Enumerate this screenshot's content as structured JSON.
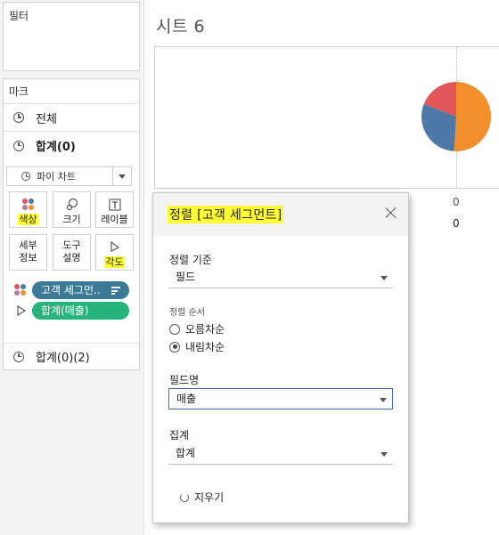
{
  "filters": {
    "title": "필터"
  },
  "marks": {
    "title": "마크",
    "all_label": "전체",
    "sum_label": "합계(0)",
    "mark_type": "파이 차트",
    "tiles": {
      "color": "색상",
      "size": "크기",
      "label": "레이블",
      "detail": "세부\n정보",
      "tooltip": "도구\n설명",
      "angle": "각도"
    },
    "pills": [
      {
        "text": "고객 세그먼..",
        "color": "#3a7a96"
      },
      {
        "text": "합계(매출)",
        "color": "#27b37c"
      }
    ],
    "sum2_label": "합계(0)(2)"
  },
  "sheet": {
    "title": "시트 6",
    "axis_zero": "0",
    "column_header": "0"
  },
  "chart_data": {
    "type": "pie",
    "categories": [
      "",
      "",
      ""
    ],
    "values": [
      51,
      30,
      19
    ],
    "colors": [
      "#f28e2b",
      "#4e79a7",
      "#e15759"
    ]
  },
  "sort_dialog": {
    "title": "정렬 [고객 세그먼트]",
    "sort_by_label": "정렬 기준",
    "sort_by_value": "필드",
    "order_label": "정렬 순서",
    "ascending_label": "오름차순",
    "descending_label": "내림차순",
    "selected_order": "descending",
    "field_name_label": "필드명",
    "field_name_value": "매출",
    "aggregation_label": "집계",
    "aggregation_value": "합계",
    "clear_label": "지우기"
  }
}
